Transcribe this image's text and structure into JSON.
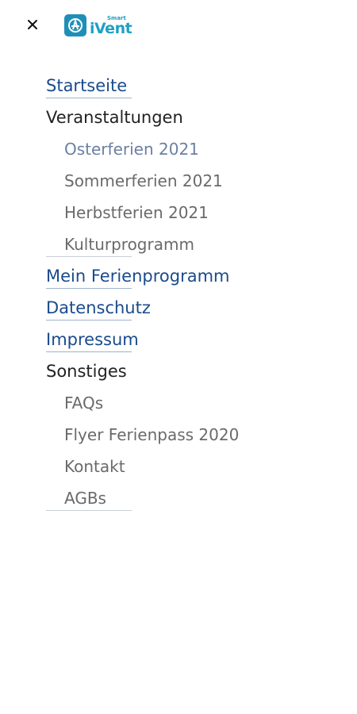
{
  "header": {
    "close_icon": "close-icon",
    "logo": {
      "small_text": "Smart",
      "word": "iVent",
      "brand_color": "#1fa0c4"
    }
  },
  "menu": {
    "startseite": "Startseite",
    "veranstaltungen": {
      "heading": "Veranstaltungen",
      "items": [
        "Osterferien 2021",
        "Sommerferien 2021",
        "Herbstferien 2021",
        "Kulturprogramm"
      ]
    },
    "mein_ferienprogramm": "Mein Ferienprogramm",
    "datenschutz": "Datenschutz",
    "impressum": "Impressum",
    "sonstiges": {
      "heading": "Sonstiges",
      "items": [
        "FAQs",
        "Flyer Ferienpass 2020",
        "Kontakt",
        "AGBs"
      ]
    }
  },
  "colors": {
    "link": "#1a4b8c",
    "heading": "#222222",
    "subitem": "#6a6a6a",
    "subitem_active": "#6c7fa2"
  }
}
